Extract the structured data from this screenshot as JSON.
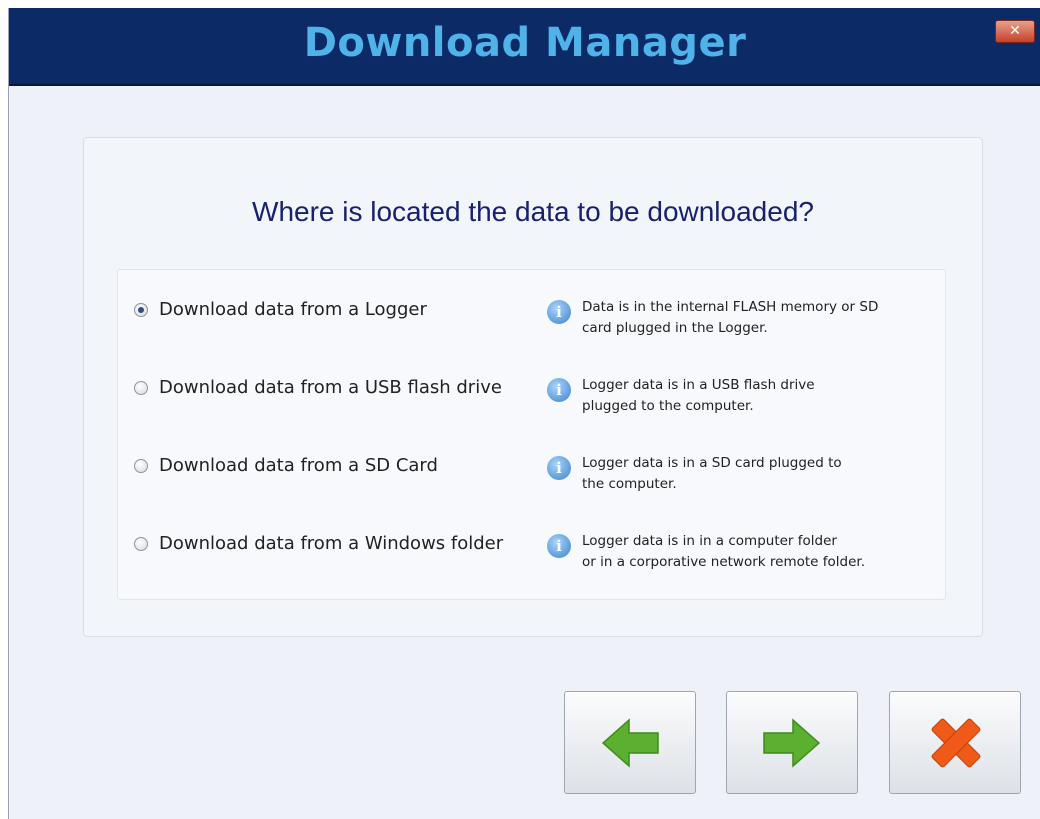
{
  "window": {
    "title": "Download Manager",
    "close_symbol": "✕"
  },
  "main": {
    "question": "Where is located the data to be downloaded?",
    "options": [
      {
        "label": "Download data from a Logger",
        "selected": true,
        "info_lines": [
          "Data is in the internal FLASH memory or SD",
          "card plugged in the Logger."
        ]
      },
      {
        "label": "Download data from a USB flash drive",
        "selected": false,
        "info_lines": [
          "Logger data is in a USB flash drive",
          "plugged to the computer."
        ]
      },
      {
        "label": "Download data from a SD Card",
        "selected": false,
        "info_lines": [
          "Logger data is in a SD card plugged to",
          "the computer."
        ]
      },
      {
        "label": "Download data from a Windows folder",
        "selected": false,
        "info_lines": [
          "Logger data is in in a computer folder",
          "or in a corporative network remote folder."
        ]
      }
    ]
  },
  "icons": {
    "info": "i",
    "back": "left-arrow-icon",
    "next": "right-arrow-icon",
    "cancel": "x-icon"
  },
  "colors": {
    "titlebar": "#0c2a66",
    "title_text": "#4fb3ea",
    "question_text": "#17216f",
    "arrow_green": "#5bb12f",
    "cancel_orange": "#ef5a19"
  }
}
